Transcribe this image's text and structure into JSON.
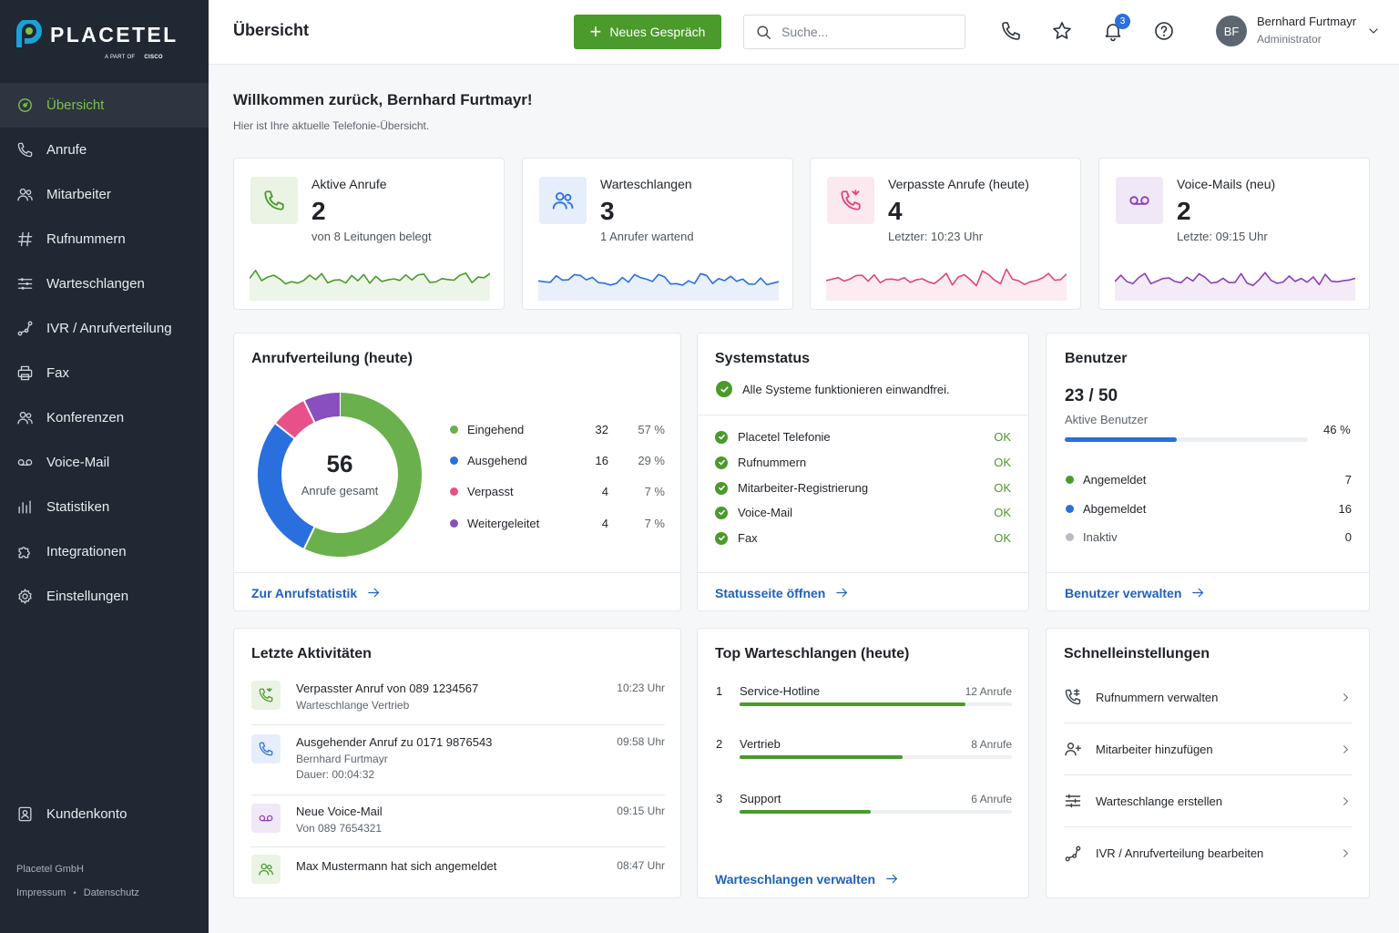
{
  "brand": {
    "name": "PLACETEL",
    "sub": "A PART OF",
    "partner": "CISCO",
    "green": "#4a9a2c",
    "blue": "#2a6fde"
  },
  "sidebar": {
    "items": [
      {
        "label": "Übersicht",
        "icon": "dashboard-icon"
      },
      {
        "label": "Anrufe",
        "icon": "phone-icon"
      },
      {
        "label": "Mitarbeiter",
        "icon": "users-icon"
      },
      {
        "label": "Rufnummern",
        "icon": "hash-icon"
      },
      {
        "label": "Warteschlangen",
        "icon": "list-icon"
      },
      {
        "label": "IVR / Anrufverteilung",
        "icon": "routing-icon"
      },
      {
        "label": "Fax",
        "icon": "printer-icon"
      },
      {
        "label": "Konferenzen",
        "icon": "conference-icon"
      },
      {
        "label": "Voice-Mail",
        "icon": "voicemail-icon"
      },
      {
        "label": "Statistiken",
        "icon": "bar-chart-icon"
      },
      {
        "label": "Integrationen",
        "icon": "puzzle-icon"
      },
      {
        "label": "Einstellungen",
        "icon": "gear-icon"
      }
    ],
    "account": "Kundenkonto",
    "company": "Placetel GmbH",
    "imprint": "Impressum",
    "sep": "•",
    "privacy": "Datenschutz"
  },
  "topbar": {
    "title": "Übersicht",
    "new_call": "Neues Gespräch",
    "search_placeholder": "Suche...",
    "notifications": "3",
    "avatar": "BF",
    "user_name": "Bernhard Furtmayr",
    "user_role": "Administrator"
  },
  "welcome": {
    "title": "Willkommen zurück, Bernhard Furtmayr!",
    "subtitle": "Hier ist Ihre aktuelle Telefonie-Übersicht."
  },
  "stats": [
    {
      "label": "Aktive Anrufe",
      "value": "2",
      "sub": "von 8 Leitungen belegt",
      "color": "#4a9a2c",
      "bg": "#eaf3e4",
      "icon": "phone-icon"
    },
    {
      "label": "Warteschlangen",
      "value": "3",
      "sub": "1 Anrufer wartend",
      "color": "#2a6fde",
      "bg": "#e6eefb",
      "icon": "users-icon"
    },
    {
      "label": "Verpasste Anrufe (heute)",
      "value": "4",
      "sub": "Letzter: 10:23 Uhr",
      "color": "#e0457b",
      "bg": "#fce8ef",
      "icon": "missed-call-icon"
    },
    {
      "label": "Voice-Mails (neu)",
      "value": "2",
      "sub": "Letzte: 09:15 Uhr",
      "color": "#8a3fb5",
      "bg": "#f1e8f7",
      "icon": "voicemail-icon"
    }
  ],
  "distribution": {
    "title": "Anrufverteilung (heute)",
    "total": "56",
    "total_label": "Anrufe gesamt",
    "link": "Zur Anrufstatistik",
    "chart_data": {
      "type": "pie",
      "categories": [
        "Eingehend",
        "Ausgehend",
        "Verpasst",
        "Weitergeleitet"
      ],
      "values": [
        32,
        16,
        4,
        4
      ],
      "percent_labels": [
        "57 %",
        "29 %",
        "7 %",
        "7 %"
      ],
      "colors": [
        "#6ab04c",
        "#2a6fde",
        "#e8508a",
        "#8a4fbf"
      ]
    }
  },
  "system": {
    "title": "Systemstatus",
    "summary": "Alle Systeme funktionieren einwandfrei.",
    "items": [
      {
        "name": "Placetel Telefonie",
        "status": "OK"
      },
      {
        "name": "Rufnummern",
        "status": "OK"
      },
      {
        "name": "Mitarbeiter-Registrierung",
        "status": "OK"
      },
      {
        "name": "Voice-Mail",
        "status": "OK"
      },
      {
        "name": "Fax",
        "status": "OK"
      }
    ],
    "link": "Statusseite öffnen"
  },
  "users": {
    "title": "Benutzer",
    "count": "23 / 50",
    "count_label": "Aktive Benutzer",
    "percent": "46 %",
    "progress": 0.46,
    "rows": [
      {
        "label": "Angemeldet",
        "value": "7",
        "color": "#4a9a2c"
      },
      {
        "label": "Abgemeldet",
        "value": "16",
        "color": "#2a6fde"
      },
      {
        "label": "Inaktiv",
        "value": "0",
        "color": "#b7bcc1"
      }
    ],
    "link": "Benutzer verwalten"
  },
  "activity": {
    "title": "Letzte Aktivitäten",
    "items": [
      {
        "title": "Verpasster Anruf von 089 1234567",
        "sub": "Warteschlange Vertrieb",
        "sub2": "",
        "time": "10:23 Uhr",
        "icon": "missed-call-icon"
      },
      {
        "title": "Ausgehender Anruf zu 0171 9876543",
        "sub": "Bernhard Furtmayr",
        "sub2": "Dauer: 00:04:32",
        "time": "09:58 Uhr",
        "icon": "phone-icon"
      },
      {
        "title": "Neue Voice-Mail",
        "sub": "Von 089 7654321",
        "sub2": "",
        "time": "09:15 Uhr",
        "icon": "voicemail-icon"
      },
      {
        "title": "Max Mustermann hat sich angemeldet",
        "sub": "",
        "sub2": "",
        "time": "08:47 Uhr",
        "icon": "user-icon"
      }
    ]
  },
  "queues": {
    "title": "Top Warteschlangen (heute)",
    "items": [
      {
        "rank": "1",
        "name": "Service-Hotline",
        "count": "12 Anrufe",
        "fraction": 0.83
      },
      {
        "rank": "2",
        "name": "Vertrieb",
        "count": "8 Anrufe",
        "fraction": 0.6
      },
      {
        "rank": "3",
        "name": "Support",
        "count": "6 Anrufe",
        "fraction": 0.48
      }
    ],
    "link": "Warteschlangen verwalten"
  },
  "quick": {
    "title": "Schnelleinstellungen",
    "items": [
      {
        "label": "Rufnummern verwalten",
        "icon": "phone-settings-icon"
      },
      {
        "label": "Mitarbeiter hinzufügen",
        "icon": "add-user-icon"
      },
      {
        "label": "Warteschlange erstellen",
        "icon": "sliders-icon"
      },
      {
        "label": "IVR / Anrufverteilung bearbeiten",
        "icon": "routing-icon"
      }
    ]
  }
}
